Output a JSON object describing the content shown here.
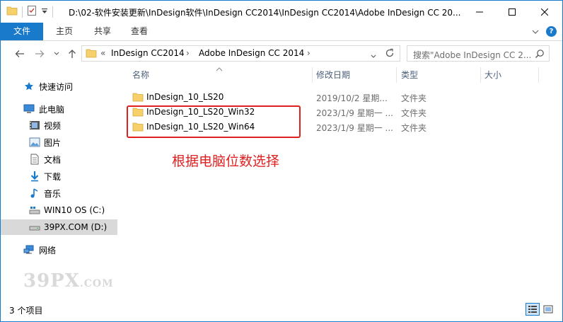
{
  "window": {
    "title": "D:\\02-软件安装更新\\InDesign软件\\InDesign CC2014\\InDesign CC2014\\Adobe InDesign CC 20..."
  },
  "ribbon": {
    "tabs": [
      {
        "label": "文件",
        "active": true
      },
      {
        "label": "主页",
        "active": false
      },
      {
        "label": "共享",
        "active": false
      },
      {
        "label": "查看",
        "active": false
      }
    ]
  },
  "address": {
    "overflow": "«",
    "crumbs": [
      "InDesign CC2014",
      "Adobe InDesign CC 2014"
    ],
    "search_placeholder": "搜索\"Adobe InDesign CC 2..."
  },
  "sidebar": {
    "items": [
      {
        "label": "快速访问",
        "icon": "star-icon"
      },
      {
        "label": "此电脑",
        "icon": "computer-icon"
      },
      {
        "label": "视频",
        "icon": "video-icon"
      },
      {
        "label": "图片",
        "icon": "picture-icon"
      },
      {
        "label": "文档",
        "icon": "document-icon"
      },
      {
        "label": "下载",
        "icon": "download-icon"
      },
      {
        "label": "音乐",
        "icon": "music-icon"
      },
      {
        "label": "WIN10 OS (C:)",
        "icon": "drive-c-icon"
      },
      {
        "label": "39PX.COM (D:)",
        "icon": "drive-d-icon",
        "selected": true
      },
      {
        "label": "网络",
        "icon": "network-icon"
      }
    ]
  },
  "columns": {
    "name": "名称",
    "date": "修改日期",
    "type": "类型",
    "size": "大小"
  },
  "files": [
    {
      "name": "InDesign_10_LS20",
      "date": "2019/10/2 星期...",
      "type": "文件夹"
    },
    {
      "name": "InDesign_10_LS20_Win32",
      "date": "2023/1/9 星期一 ...",
      "type": "文件夹"
    },
    {
      "name": "InDesign_10_LS20_Win64",
      "date": "2023/1/9 星期一 ...",
      "type": "文件夹"
    }
  ],
  "annotation": "根据电脑位数选择",
  "status": {
    "count": "3 个项目"
  },
  "watermark": {
    "main": "39PX",
    "suffix": ".COM"
  },
  "colors": {
    "accent": "#1979ca",
    "highlight_red": "#e02020",
    "folder": "#f6d06b"
  }
}
